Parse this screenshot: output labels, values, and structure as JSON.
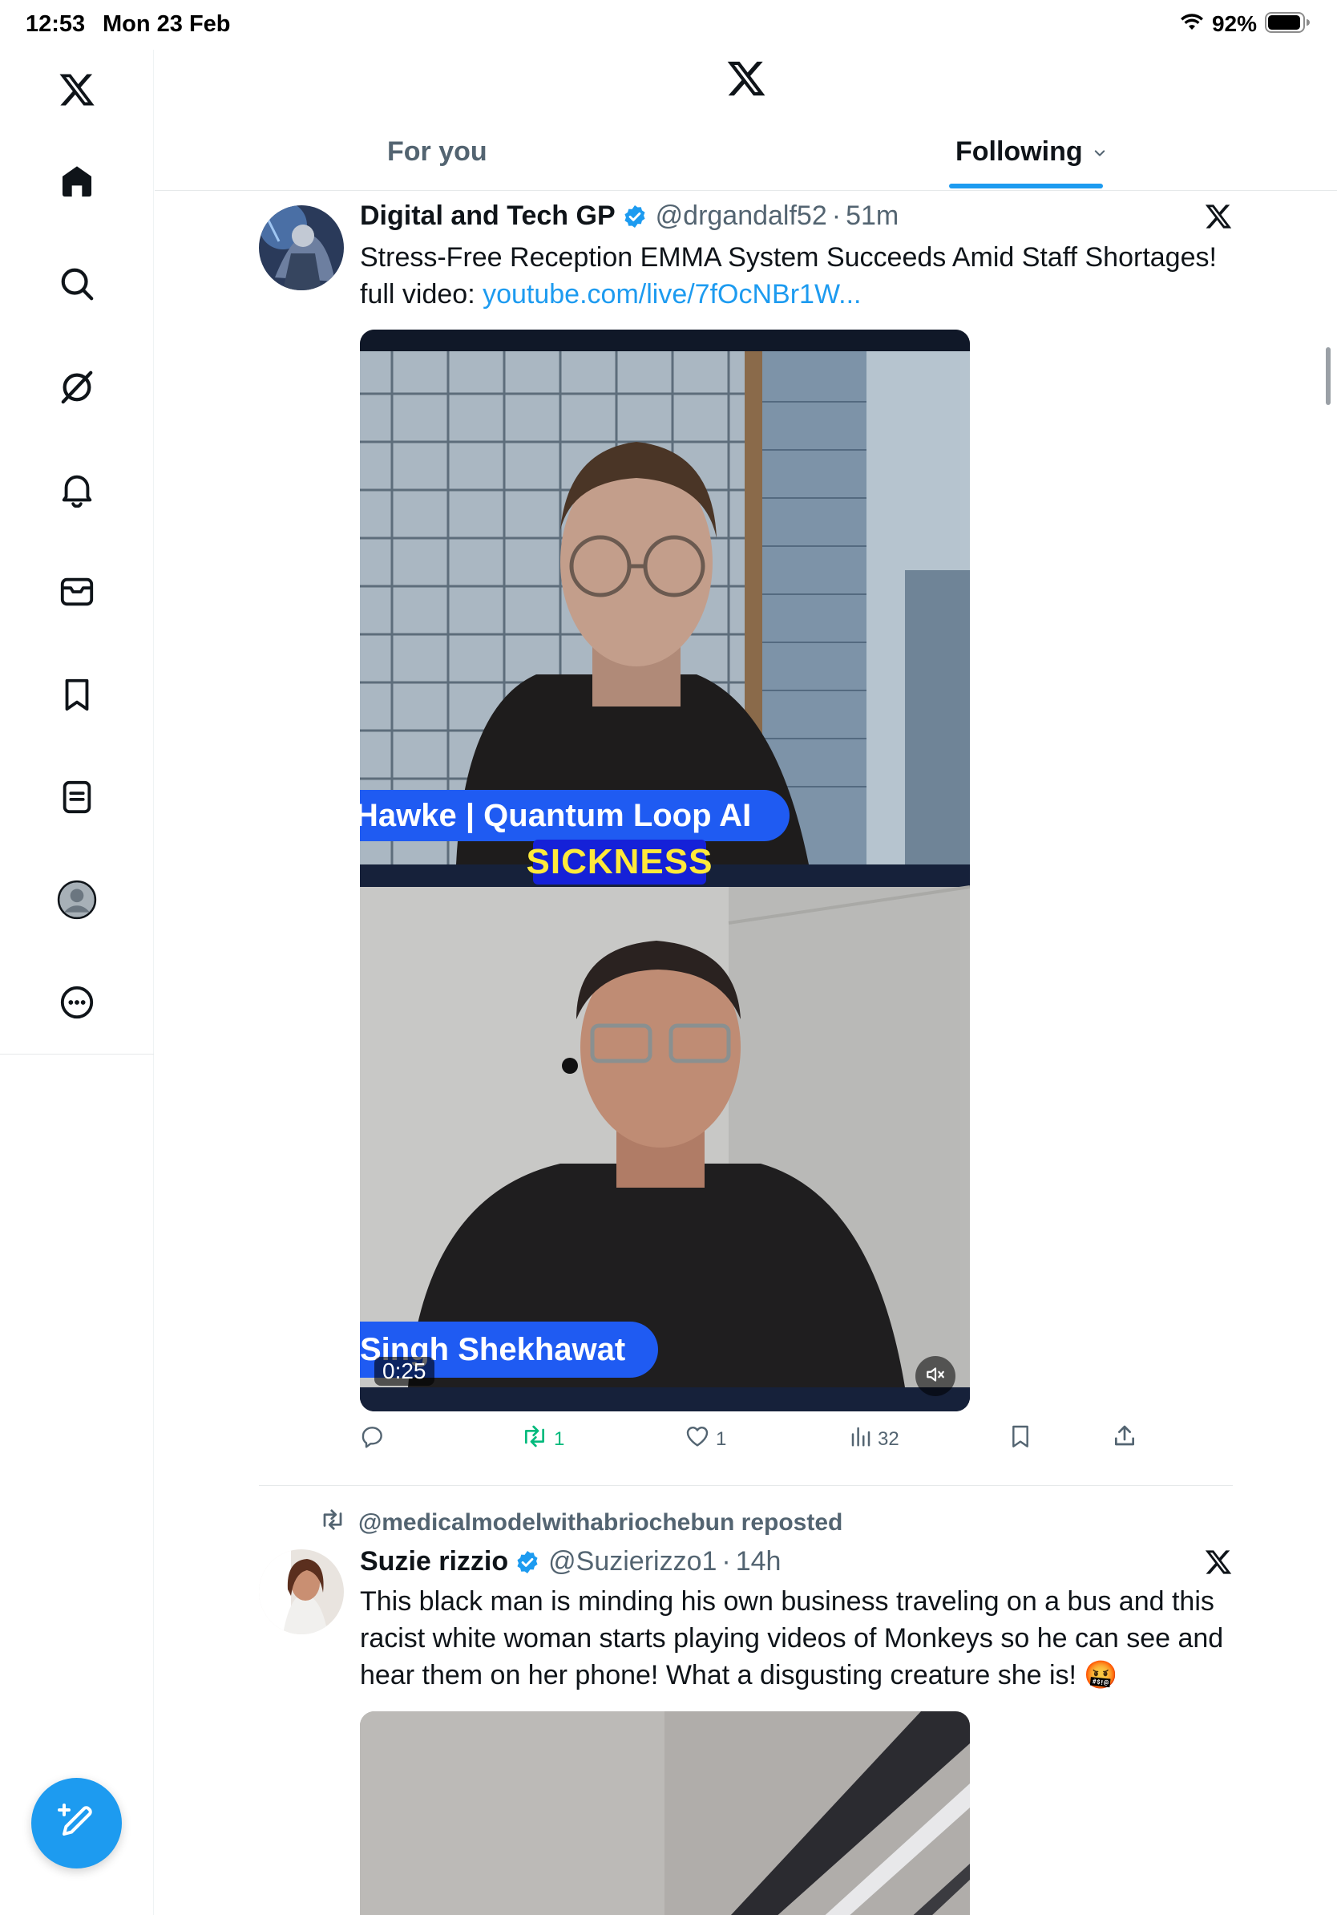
{
  "status_bar": {
    "time": "12:53",
    "date": "Mon 23 Feb",
    "battery_pct": "92%"
  },
  "sidebar": {
    "items": [
      {
        "name": "x-logo",
        "icon": "x-logo-icon"
      },
      {
        "name": "home",
        "icon": "home-icon"
      },
      {
        "name": "explore",
        "icon": "search-icon"
      },
      {
        "name": "grok",
        "icon": "grok-icon"
      },
      {
        "name": "notifications",
        "icon": "bell-icon"
      },
      {
        "name": "messages",
        "icon": "envelope-icon"
      },
      {
        "name": "bookmarks",
        "icon": "bookmark-icon"
      },
      {
        "name": "lists",
        "icon": "list-icon"
      },
      {
        "name": "profile",
        "icon": "avatar-icon"
      },
      {
        "name": "more",
        "icon": "more-icon"
      }
    ],
    "compose_icon": "compose-icon"
  },
  "header": {
    "tabs": [
      {
        "label": "For you",
        "active": false
      },
      {
        "label": "Following",
        "active": true
      }
    ]
  },
  "posts": [
    {
      "author_name": "Digital and Tech GP",
      "verified": true,
      "handle": "@drgandalf52",
      "separator": "·",
      "time": "51m",
      "text": "Stress-Free Reception EMMA System Succeeds Amid Staff Shortages!",
      "text_prefix": "full video:",
      "link": "youtube.com/live/7fOcNBr1W...",
      "video": {
        "lower_third_top": "Hawke | Quantum Loop AI",
        "caption": "SICKNESS",
        "lower_third_bottom": "Singh Shekhawat",
        "duration": "0:25",
        "muted": true
      },
      "actions": {
        "reply_count": "",
        "repost_count": "1",
        "like_count": "1",
        "views_count": "32"
      }
    },
    {
      "reposted_by": "@medicalmodelwithabriochebun reposted",
      "author_name": "Suzie rizzio",
      "verified": true,
      "handle": "@Suzierizzo1",
      "separator": "·",
      "time": "14h",
      "text": "This black man is minding his own business traveling on a bus and this racist white woman starts playing videos of Monkeys so he can see and hear them on her phone! What a disgusting creature she is! 🤬"
    }
  ],
  "colors": {
    "accent": "#1d9bf0",
    "text_primary": "#0f1419",
    "text_secondary": "#536471",
    "repost_green": "#00ba7c",
    "caption_yellow": "#ffe93b"
  }
}
